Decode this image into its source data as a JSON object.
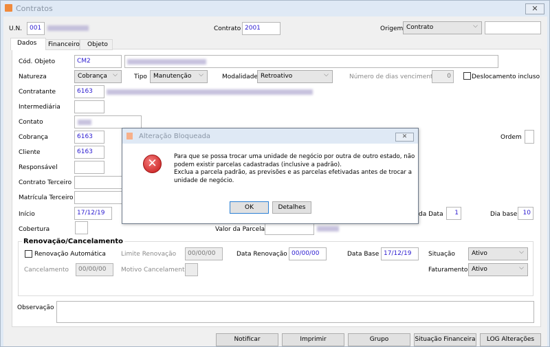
{
  "window": {
    "title": "Contratos",
    "close": "✕"
  },
  "header": {
    "un_label": "U.N.",
    "un_value": "001",
    "contrato_label": "Contrato",
    "contrato_value": "2001",
    "origem_label": "Origem",
    "origem_value": "Contrato",
    "origem_extra": ""
  },
  "tabs": [
    {
      "label": "Dados"
    },
    {
      "label": "Financeiro"
    },
    {
      "label": "Objeto"
    }
  ],
  "form": {
    "cod_objeto_label": "Cód. Objeto",
    "cod_objeto": "CM2",
    "natureza_label": "Natureza",
    "natureza": "Cobrança",
    "tipo_label": "Tipo",
    "tipo": "Manutenção",
    "modalidade_label": "Modalidade",
    "modalidade": "Retroativo",
    "dias_label": "Número de dias vencimento",
    "dias": "0",
    "deslocamento_label": "Deslocamento incluso",
    "contratante_label": "Contratante",
    "contratante": "6163",
    "intermediaria_label": "Intermediária",
    "contato_label": "Contato",
    "cobranca_label": "Cobrança",
    "cobranca": "6163",
    "cliente_label": "Cliente",
    "cliente": "6163",
    "ordem_label": "Ordem",
    "responsavel_label": "Responsável",
    "contrato_terceiro_label": "Contrato Terceiro",
    "matricula_label": "Matrícula Terceiro",
    "inicio_label": "Início",
    "inicio": "17/12/19",
    "da_data_label": "da Data",
    "da_data": "1",
    "dia_base_label": "Dia base",
    "dia_base": "10",
    "cobertura_label": "Cobertura",
    "valor_parcela_label": "Valor da Parcela"
  },
  "renovacao": {
    "legend": "Renovação/Cancelamento",
    "auto_label": "Renovação Automática",
    "limite_label": "Limite Renovação",
    "limite": "00/00/00",
    "data_renov_label": "Data Renovação",
    "data_renov": "00/00/00",
    "data_base_label": "Data Base",
    "data_base": "17/12/19",
    "situacao_label": "Situação",
    "situacao": "Ativo",
    "cancelamento_label": "Cancelamento",
    "cancelamento": "00/00/00",
    "motivo_label": "Motivo Cancelamento",
    "faturamento_label": "Faturamento",
    "faturamento": "Ativo"
  },
  "observacao_label": "Observação",
  "buttons": [
    "Notificar",
    "Imprimir",
    "Grupo",
    "Situação Financeira",
    "LOG Alterações"
  ],
  "dialog": {
    "title": "Alteração Bloqueada",
    "close": "✕",
    "line1": "Para que se possa trocar uma unidade de negócio por outra de outro estado, não",
    "line2": "podem existir parcelas cadastradas (inclusive a padrão).",
    "line3": "Exclua a parcela padrão, as previsões e as parcelas efetivadas antes de trocar a",
    "line4": "unidade de negócio.",
    "ok": "OK",
    "details": "Detalhes",
    "icon": "error-icon"
  }
}
